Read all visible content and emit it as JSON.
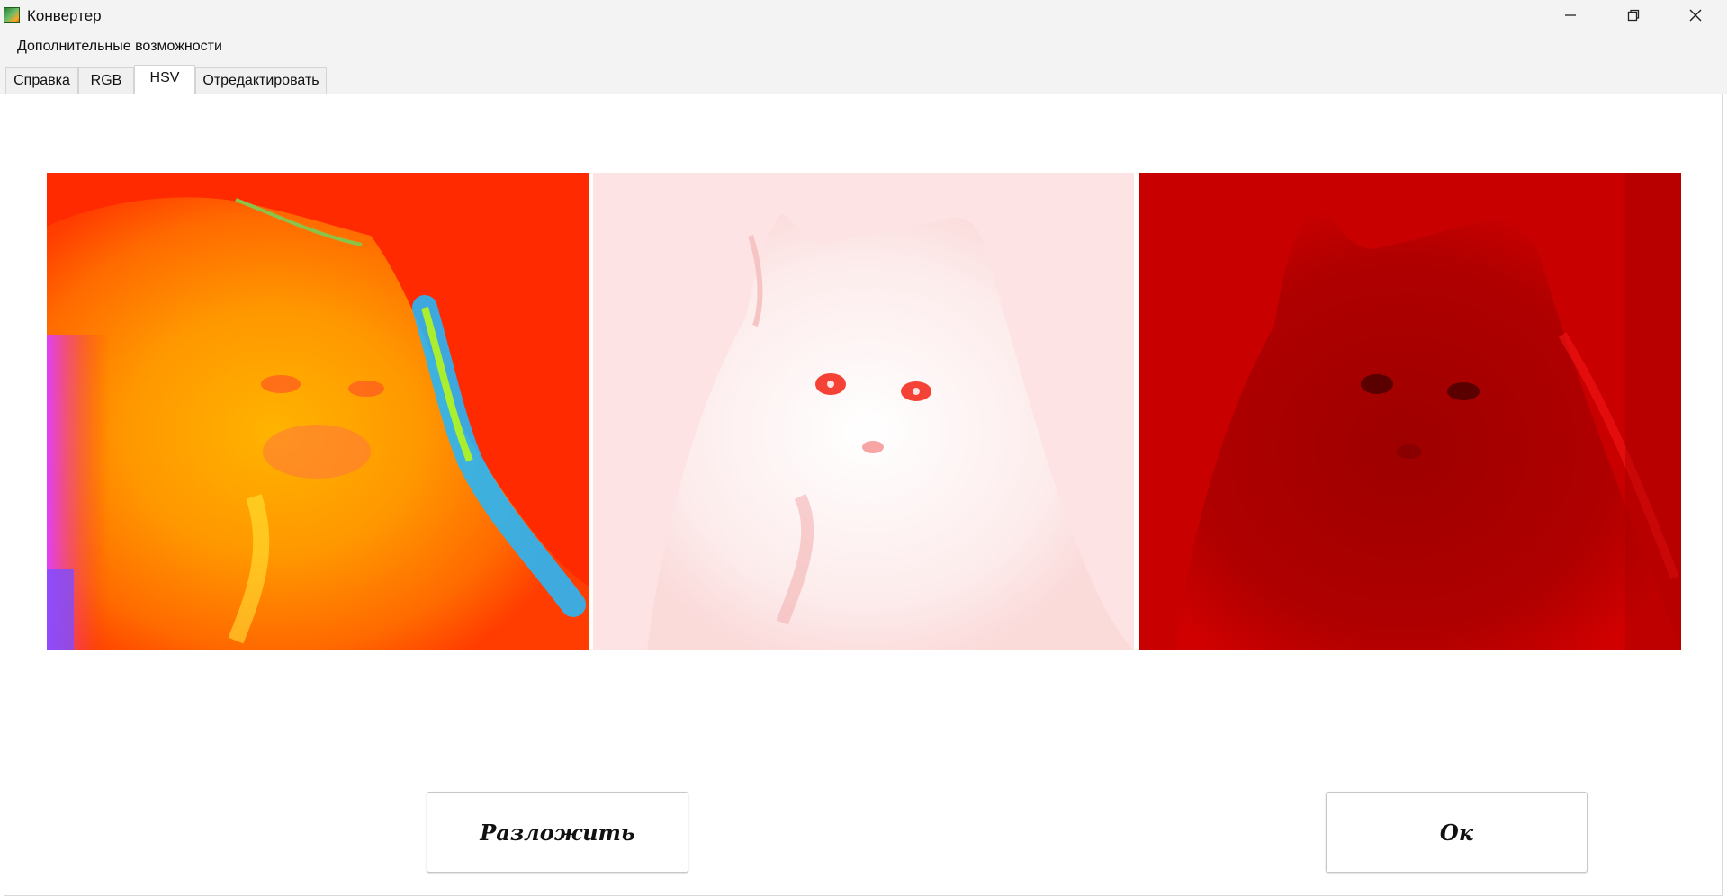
{
  "window": {
    "title": "Конвертер",
    "icons": [
      "app-icon",
      "minimize-icon",
      "restore-icon",
      "close-icon"
    ]
  },
  "menu": {
    "items": [
      "Дополнительные возможности"
    ]
  },
  "tabs": {
    "items": [
      "Справка",
      "RGB",
      "HSV",
      "Отредактировать"
    ],
    "active": "HSV"
  },
  "images": {
    "hue": {
      "alt": "hue-channel-image"
    },
    "saturation": {
      "alt": "saturation-channel-image"
    },
    "value": {
      "alt": "value-channel-image"
    }
  },
  "buttons": {
    "decompose": "Разложить",
    "ok": "Ок"
  },
  "colors": {
    "chrome": "#f3f3f3",
    "hue_bg": "#ff2a00",
    "saturation_bg": "#fde3e3",
    "value_bg": "#c80000"
  }
}
